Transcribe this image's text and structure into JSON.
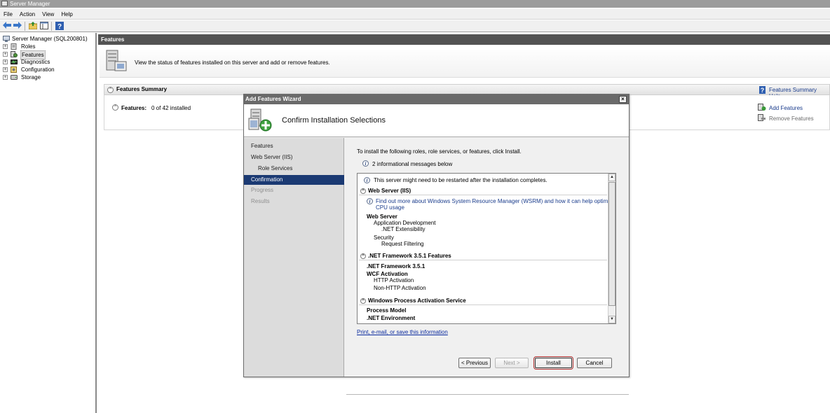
{
  "window": {
    "title": "Server Manager"
  },
  "menu": [
    "File",
    "Action",
    "View",
    "Help"
  ],
  "toolbar_icons": [
    "back-arrow-icon",
    "forward-arrow-icon",
    "up-folder-icon",
    "show-hide-tree-icon",
    "help-icon"
  ],
  "tree": {
    "root": "Server Manager (SQL200801)",
    "items": [
      {
        "label": "Roles",
        "icon": "roles-icon",
        "selected": false
      },
      {
        "label": "Features",
        "icon": "features-icon",
        "selected": true
      },
      {
        "label": "Diagnostics",
        "icon": "diagnostics-icon",
        "selected": false
      },
      {
        "label": "Configuration",
        "icon": "configuration-icon",
        "selected": false
      },
      {
        "label": "Storage",
        "icon": "storage-icon",
        "selected": false
      }
    ]
  },
  "content": {
    "header": "Features",
    "intro": "View the status of features installed on this server and add or remove features.",
    "summary_title": "Features Summary",
    "summary_help": "Features Summary Help",
    "features_label": "Features:",
    "features_count": "0 of 42 installed",
    "actions": {
      "add": "Add Features",
      "remove": "Remove Features"
    }
  },
  "wizard": {
    "title": "Add Features Wizard",
    "heading": "Confirm Installation Selections",
    "nav": [
      {
        "label": "Features",
        "state": "normal",
        "sub": false
      },
      {
        "label": "Web Server (IIS)",
        "state": "normal",
        "sub": false
      },
      {
        "label": "Role Services",
        "state": "normal",
        "sub": true
      },
      {
        "label": "Confirmation",
        "state": "active",
        "sub": false
      },
      {
        "label": "Progress",
        "state": "disabled",
        "sub": false
      },
      {
        "label": "Results",
        "state": "disabled",
        "sub": false
      }
    ],
    "instruction": "To install the following roles, role services, or features, click Install.",
    "messages_note": "2 informational messages below",
    "list": {
      "restart_note": "This server might need to be restarted after the installation completes.",
      "sec_iis": "Web Server (IIS)",
      "wsrm_link_1": "Find out more about Windows System Resource Manager (WSRM) and how it can help optimize",
      "wsrm_link_2": "CPU usage",
      "web_server": "Web Server",
      "app_dev": "Application Development",
      "net_ext": ".NET Extensibility",
      "security": "Security",
      "req_filter": "Request Filtering",
      "sec_net": ".NET Framework 3.5.1 Features",
      "net_fw": ".NET Framework 3.5.1",
      "wcf": "WCF Activation",
      "http_act": "HTTP Activation",
      "non_http_act": "Non-HTTP Activation",
      "sec_was": "Windows Process Activation Service",
      "process_model": "Process Model",
      "net_env": ".NET Environment"
    },
    "print_link": "Print, e-mail, or save this information",
    "buttons": {
      "previous": "< Previous",
      "next": "Next >",
      "install": "Install",
      "cancel": "Cancel"
    }
  }
}
